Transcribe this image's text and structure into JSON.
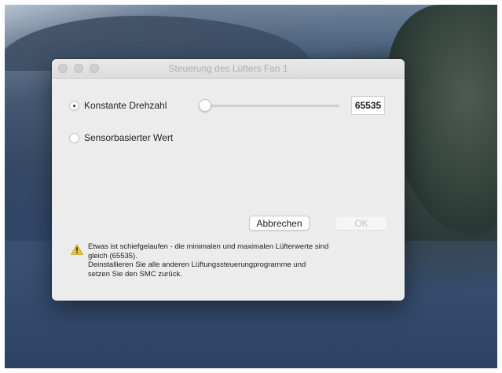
{
  "window": {
    "title": "Steuerung des Lüfters Fan 1"
  },
  "mode": {
    "options": [
      {
        "label": "Konstante Drehzahl",
        "selected": true
      },
      {
        "label": "Sensorbasierter Wert",
        "selected": false
      }
    ]
  },
  "speed": {
    "value": "65535",
    "slider_level": 0
  },
  "buttons": {
    "cancel": "Abbrechen",
    "ok": "OK"
  },
  "warning": {
    "icon": "warning-triangle-icon",
    "lines": [
      "Etwas ist schiefgelaufen - die minimalen und maximalen Lüfterwerte sind",
      "gleich (65535).",
      "Deinstallieren Sie alle anderen Lüftungssteuerungprogramme und",
      "setzen Sie den SMC zurück."
    ]
  },
  "colors": {
    "dialog_bg": "#ececec",
    "warning_yellow": "#f2c230"
  }
}
